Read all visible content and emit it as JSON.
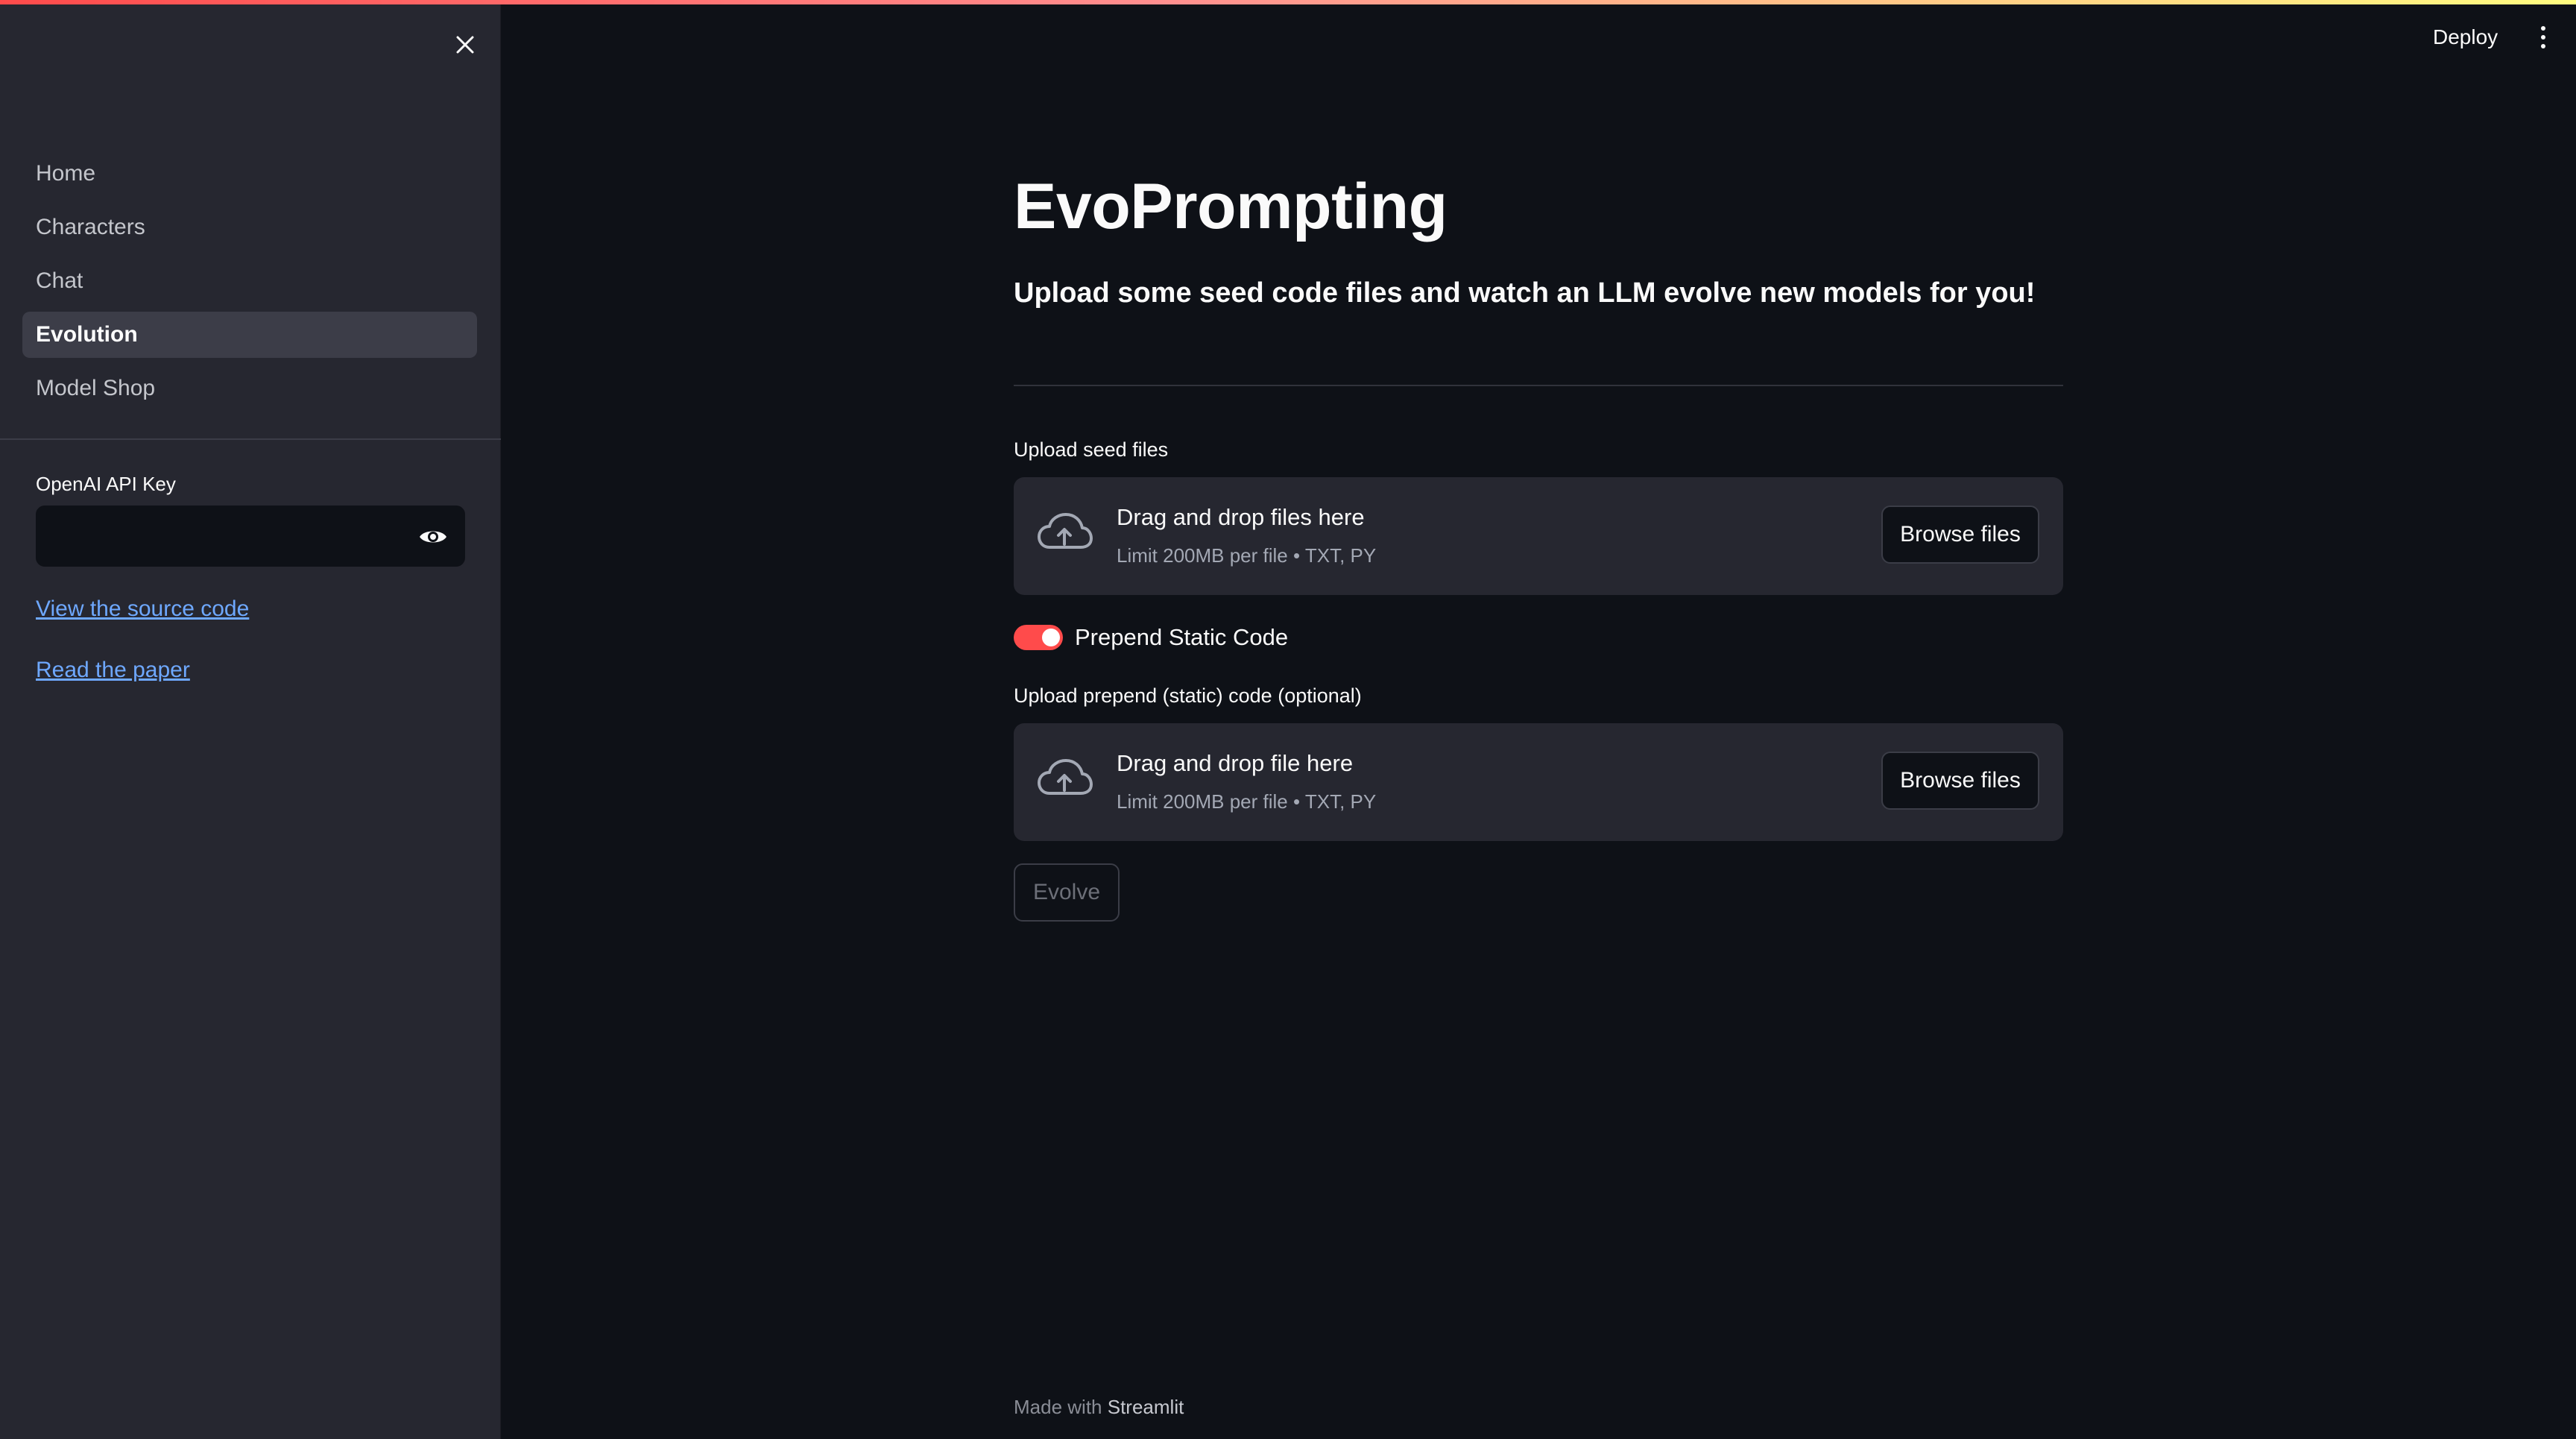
{
  "sidebar": {
    "nav_items": [
      {
        "label": "Home",
        "active": false
      },
      {
        "label": "Characters",
        "active": false
      },
      {
        "label": "Chat",
        "active": false
      },
      {
        "label": "Evolution",
        "active": true
      },
      {
        "label": "Model Shop",
        "active": false
      }
    ],
    "api_key_label": "OpenAI API Key",
    "api_key_value": "",
    "links": {
      "source_code": "View the source code",
      "paper": "Read the paper"
    }
  },
  "header": {
    "deploy_label": "Deploy"
  },
  "main": {
    "title": "EvoPrompting",
    "subtitle": "Upload some seed code files and watch an LLM evolve new models for you!",
    "seed_upload": {
      "label": "Upload seed files",
      "drop_text": "Drag and drop files here",
      "limit_text": "Limit 200MB per file • TXT, PY",
      "browse_label": "Browse files"
    },
    "prepend_toggle": {
      "label": "Prepend Static Code",
      "on": true
    },
    "static_upload": {
      "label": "Upload prepend (static) code (optional)",
      "drop_text": "Drag and drop file here",
      "limit_text": "Limit 200MB per file • TXT, PY",
      "browse_label": "Browse files"
    },
    "evolve_label": "Evolve"
  },
  "footer": {
    "prefix": "Made with",
    "brand": "Streamlit"
  },
  "colors": {
    "background": "#0e1117",
    "sidebar": "#262730",
    "accent": "#ff4b4b",
    "link": "#6ea8fe"
  }
}
